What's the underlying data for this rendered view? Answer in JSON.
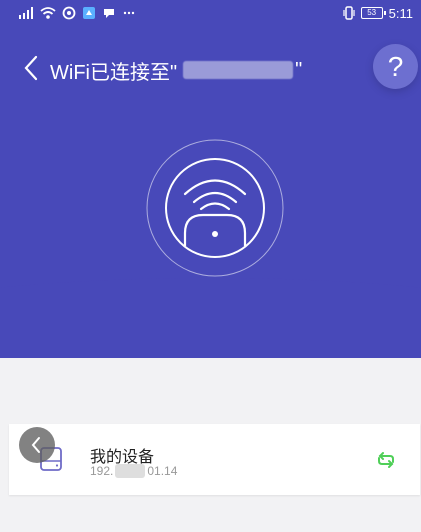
{
  "status_bar": {
    "time": "5:11",
    "battery_level": "53",
    "left_icons": [
      "signal-icon",
      "wifi-icon",
      "vpn-icon",
      "app-icon",
      "message-icon",
      "more-icon"
    ],
    "right_icons": [
      "vibrate-icon",
      "battery-icon"
    ]
  },
  "header": {
    "title_prefix": "WiFi已连接至\"",
    "title_suffix": "\"",
    "help_label": "?"
  },
  "device": {
    "name": "我的设备",
    "ip_prefix": "192.",
    "ip_suffix": "01.14"
  },
  "colors": {
    "header": "#4849b9",
    "background": "#f2f2f4",
    "accent_green": "#4fcf58"
  }
}
